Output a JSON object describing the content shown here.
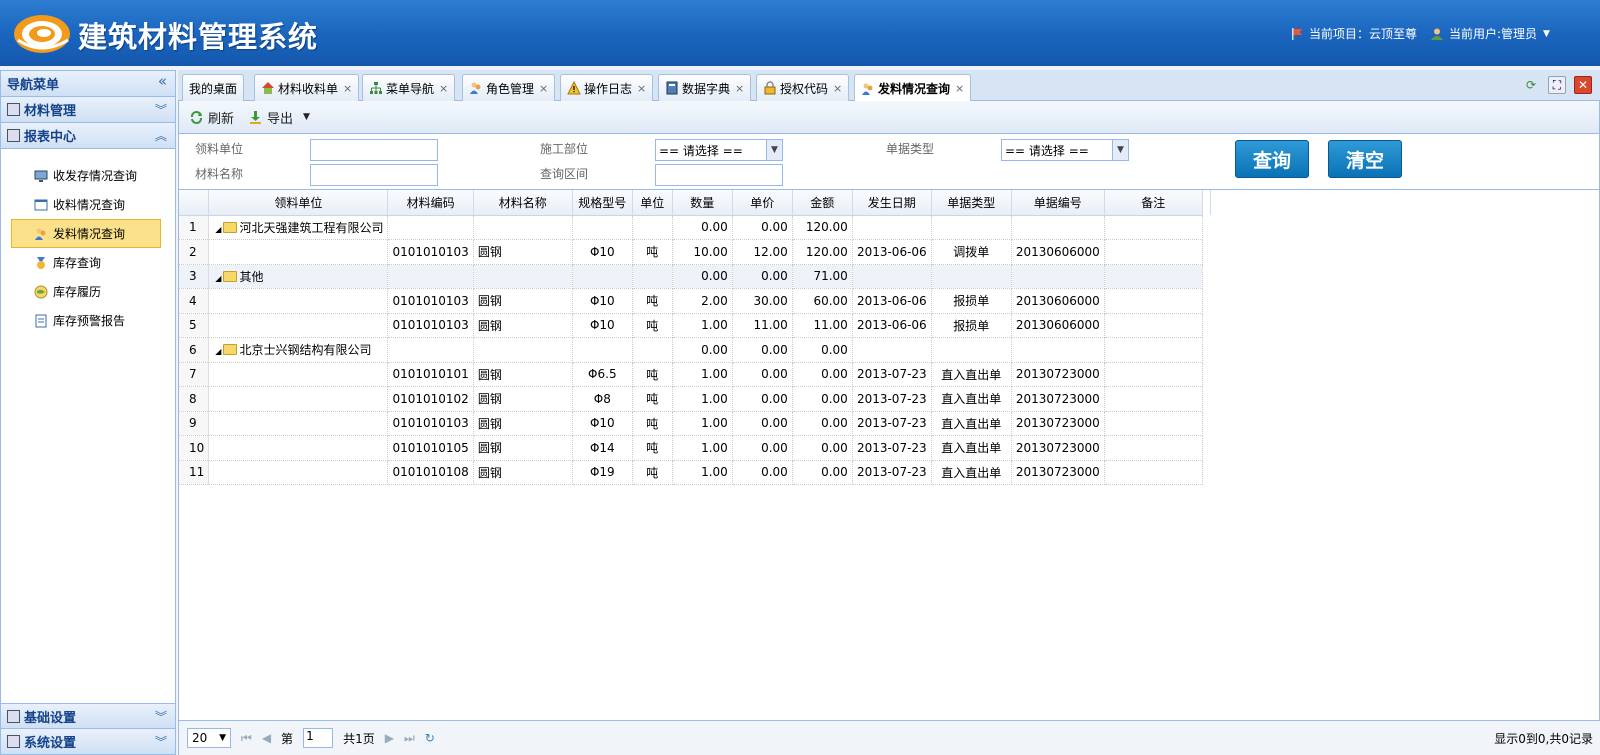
{
  "header": {
    "title": "建筑材料管理系统",
    "project_label": "当前项目：云顶至尊",
    "user_label": "当前用户:管理员",
    "dropdown_glyph": "▼"
  },
  "sidebar": {
    "title": "导航菜单",
    "collapse_glyph": "«",
    "sections": [
      {
        "label": "材料管理",
        "glyph": "︾"
      },
      {
        "label": "报表中心",
        "glyph": "︽"
      }
    ],
    "items": [
      {
        "label": "收发存情况查询",
        "icon": "monitor-icon"
      },
      {
        "label": "收料情况查询",
        "icon": "window-icon"
      },
      {
        "label": "发料情况查询",
        "icon": "users-icon"
      },
      {
        "label": "库存查询",
        "icon": "medal-icon"
      },
      {
        "label": "库存履历",
        "icon": "globe-icon"
      },
      {
        "label": "库存预警报告",
        "icon": "document-icon"
      }
    ],
    "bottom_sections": [
      {
        "label": "基础设置",
        "glyph": "︾"
      },
      {
        "label": "系统设置",
        "glyph": "︾"
      }
    ]
  },
  "tabs": [
    {
      "label": "我的桌面",
      "closable": false,
      "icon": "none"
    },
    {
      "label": "材料收料单",
      "closable": true,
      "icon": "home-icon"
    },
    {
      "label": "菜单导航",
      "closable": true,
      "icon": "sitemap-icon"
    },
    {
      "label": "角色管理",
      "closable": true,
      "icon": "users-icon"
    },
    {
      "label": "操作日志",
      "closable": true,
      "icon": "warning-icon"
    },
    {
      "label": "数据字典",
      "closable": true,
      "icon": "book-icon"
    },
    {
      "label": "授权代码",
      "closable": true,
      "icon": "lock-icon"
    },
    {
      "label": "发料情况查询",
      "closable": true,
      "icon": "users-icon"
    }
  ],
  "close_glyph": "×",
  "toolbar": {
    "refresh": "刷新",
    "export": "导出",
    "export_arrow": "▼"
  },
  "filters": {
    "unit_label": "领料单位",
    "dept_label": "施工部位",
    "doc_type_label": "单据类型",
    "material_label": "材料名称",
    "range_label": "查询区间",
    "dept_value": "== 请选择 ==",
    "doc_type_value": "== 请选择 ==",
    "select_arrow": "▼",
    "query_button": "查询",
    "clear_button": "清空"
  },
  "grid": {
    "columns": [
      "领料单位",
      "材料编码",
      "材料名称",
      "规格型号",
      "单位",
      "数量",
      "单价",
      "金额",
      "发生日期",
      "单据类型",
      "单据编号",
      "备注"
    ],
    "tree_toggle": "◢",
    "rows": [
      {
        "n": "1",
        "group": "河北天强建筑工程有限公司",
        "code": "",
        "name": "",
        "spec": "",
        "unit": "",
        "qty": "0.00",
        "price": "0.00",
        "amount": "120.00",
        "date": "",
        "type": "",
        "no": "",
        "note": ""
      },
      {
        "n": "2",
        "group": "",
        "code": "0101010103",
        "name": "圆钢",
        "spec": "Φ10",
        "unit": "吨",
        "qty": "10.00",
        "price": "12.00",
        "amount": "120.00",
        "date": "2013-06-06",
        "type": "调拨单",
        "no": "20130606000",
        "note": ""
      },
      {
        "n": "3",
        "group": "其他",
        "code": "",
        "name": "",
        "spec": "",
        "unit": "",
        "qty": "0.00",
        "price": "0.00",
        "amount": "71.00",
        "date": "",
        "type": "",
        "no": "",
        "note": ""
      },
      {
        "n": "4",
        "group": "",
        "code": "0101010103",
        "name": "圆钢",
        "spec": "Φ10",
        "unit": "吨",
        "qty": "2.00",
        "price": "30.00",
        "amount": "60.00",
        "date": "2013-06-06",
        "type": "报损单",
        "no": "20130606000",
        "note": ""
      },
      {
        "n": "5",
        "group": "",
        "code": "0101010103",
        "name": "圆钢",
        "spec": "Φ10",
        "unit": "吨",
        "qty": "1.00",
        "price": "11.00",
        "amount": "11.00",
        "date": "2013-06-06",
        "type": "报损单",
        "no": "20130606000",
        "note": ""
      },
      {
        "n": "6",
        "group": "北京士兴钢结构有限公司",
        "code": "",
        "name": "",
        "spec": "",
        "unit": "",
        "qty": "0.00",
        "price": "0.00",
        "amount": "0.00",
        "date": "",
        "type": "",
        "no": "",
        "note": ""
      },
      {
        "n": "7",
        "group": "",
        "code": "0101010101",
        "name": "圆钢",
        "spec": "Φ6.5",
        "unit": "吨",
        "qty": "1.00",
        "price": "0.00",
        "amount": "0.00",
        "date": "2013-07-23",
        "type": "直入直出单",
        "no": "20130723000",
        "note": ""
      },
      {
        "n": "8",
        "group": "",
        "code": "0101010102",
        "name": "圆钢",
        "spec": "Φ8",
        "unit": "吨",
        "qty": "1.00",
        "price": "0.00",
        "amount": "0.00",
        "date": "2013-07-23",
        "type": "直入直出单",
        "no": "20130723000",
        "note": ""
      },
      {
        "n": "9",
        "group": "",
        "code": "0101010103",
        "name": "圆钢",
        "spec": "Φ10",
        "unit": "吨",
        "qty": "1.00",
        "price": "0.00",
        "amount": "0.00",
        "date": "2013-07-23",
        "type": "直入直出单",
        "no": "20130723000",
        "note": ""
      },
      {
        "n": "10",
        "group": "",
        "code": "0101010105",
        "name": "圆钢",
        "spec": "Φ14",
        "unit": "吨",
        "qty": "1.00",
        "price": "0.00",
        "amount": "0.00",
        "date": "2013-07-23",
        "type": "直入直出单",
        "no": "20130723000",
        "note": ""
      },
      {
        "n": "11",
        "group": "",
        "code": "0101010108",
        "name": "圆钢",
        "spec": "Φ19",
        "unit": "吨",
        "qty": "1.00",
        "price": "0.00",
        "amount": "0.00",
        "date": "2013-07-23",
        "type": "直入直出单",
        "no": "20130723000",
        "note": ""
      }
    ]
  },
  "pager": {
    "page_size": "20",
    "page_label": "第",
    "page_value": "1",
    "total_label": "共1页",
    "summary": "显示0到0,共0记录",
    "first_glyph": "⏮",
    "prev_glyph": "◀",
    "next_glyph": "▶",
    "last_glyph": "⏭",
    "reload_glyph": "↻"
  },
  "colors": {
    "accent": "#1a64bd",
    "active_item": "#fbe28a",
    "button": "#0a72b5"
  }
}
